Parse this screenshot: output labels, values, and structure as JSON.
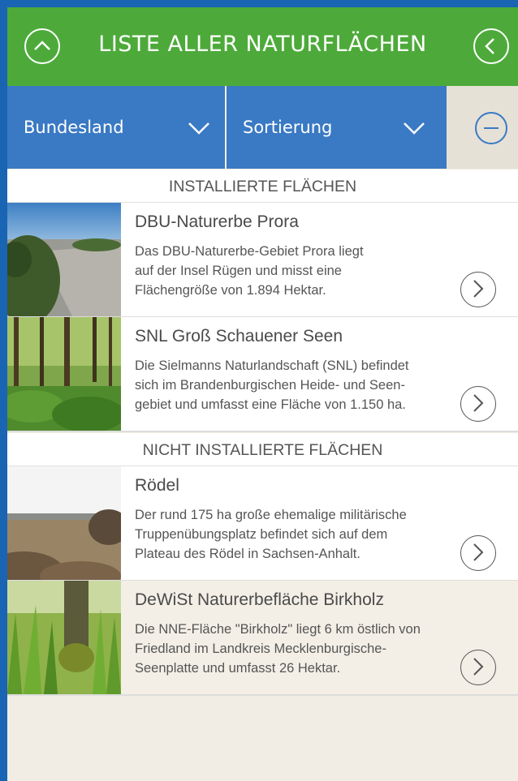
{
  "header": {
    "title": "LISTE ALLER NATURFLÄCHEN",
    "up_icon": "chevron-up-icon",
    "back_icon": "chevron-left-icon",
    "color": "#4daa3a"
  },
  "filters": {
    "bundesland_label": "Bundesland",
    "sortierung_label": "Sortierung",
    "collapse_icon": "minus-circle-icon",
    "color": "#3a79c4"
  },
  "sections": {
    "installed": "INSTALLIERTE FLÄCHEN",
    "not_installed": "NICHT INSTALLIERTE FLÄCHEN"
  },
  "installed_items": [
    {
      "name": "DBU-Naturerbe Prora",
      "desc_lines": [
        "Das DBU-Naturerbe-Gebiet Prora liegt",
        "auf der Insel Rügen und misst eine",
        "Flächengröße von 1.894 Hektar."
      ]
    },
    {
      "name": "SNL Groß Schauener Seen",
      "desc_lines": [
        "Die Sielmanns Naturlandschaft (SNL) befindet",
        "sich im Brandenburgischen Heide- und Seen-",
        "gebiet und umfasst eine Fläche von 1.150 ha."
      ]
    }
  ],
  "not_installed_items": [
    {
      "name": "Rödel",
      "desc_lines": [
        "Der rund 175 ha große ehemalige militärische",
        "Truppenübungsplatz befindet sich auf dem",
        "Plateau des Rödel in Sachsen-Anhalt."
      ]
    },
    {
      "name": "DeWiSt Naturerbefläche Birkholz",
      "desc_lines": [
        "Die NNE-Fläche \"Birkholz\" liegt 6 km östlich von",
        "Friedland im Landkreis Mecklenburgische-",
        "Seenplatte und umfasst 26 Hektar."
      ]
    }
  ],
  "item_arrow_icon": "chevron-right-icon"
}
